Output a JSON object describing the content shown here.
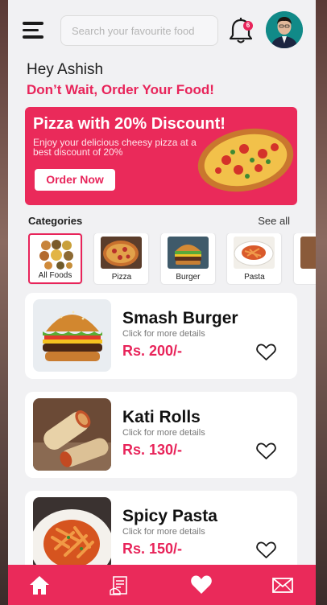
{
  "header": {
    "search_placeholder": "Search your favourite food",
    "notification_count": "6"
  },
  "greeting": "Hey Ashish",
  "tagline": "Don’t Wait, Order Your Food!",
  "promo": {
    "title": "Pizza with 20% Discount!",
    "subtitle": "Enjoy your delicious cheesy pizza at a best discount of 20%",
    "button": "Order Now"
  },
  "categories": {
    "heading": "Categories",
    "see_all": "See all",
    "items": [
      {
        "label": "All Foods",
        "active": true
      },
      {
        "label": "Pizza",
        "active": false
      },
      {
        "label": "Burger",
        "active": false
      },
      {
        "label": "Pasta",
        "active": false
      }
    ]
  },
  "foods": [
    {
      "name": "Smash Burger",
      "sub": "Click for more details",
      "price": "Rs. 200/-"
    },
    {
      "name": "Kati Rolls",
      "sub": "Click for more details",
      "price": "Rs. 130/-"
    },
    {
      "name": "Spicy Pasta",
      "sub": "Click for more details",
      "price": "Rs. 150/-"
    }
  ],
  "nav": {
    "icons": [
      "home-icon",
      "menu-card-icon",
      "heart-icon",
      "mail-icon"
    ]
  },
  "colors": {
    "accent": "#e8245a",
    "background": "#f1f1f3"
  }
}
